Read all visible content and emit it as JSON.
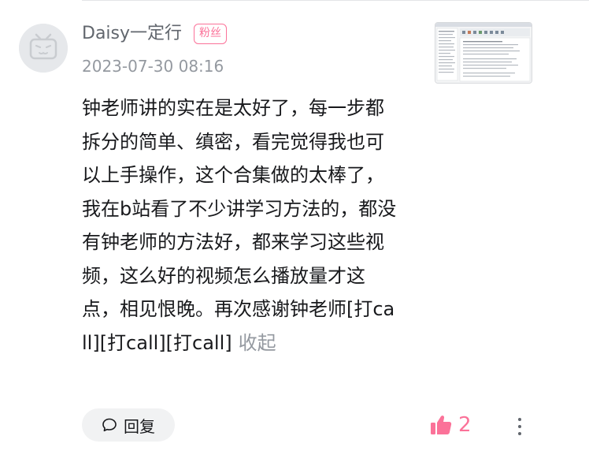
{
  "comment": {
    "username": "Daisy一定行",
    "badge": "粉丝",
    "timestamp": "2023-07-30 08:16",
    "text": "钟老师讲的实在是太好了，每一步都拆分的简单、缜密，看完觉得我也可以上手操作，这个合集做的太棒了，我在b站看了不少讲学习方法的，都没有钟老师的方法好，都来学习这些视频，这么好的视频怎么播放量才这点，相见恨晚。再次感谢钟老师[打call][打call][打call]",
    "collapse_label": "收起"
  },
  "actions": {
    "reply_label": "回复",
    "like_count": "2"
  },
  "icons": {
    "avatar": "bilibili-tv-avatar-icon",
    "reply": "chat-bubble-icon",
    "like": "thumbs-up-icon",
    "more": "vertical-dots-icon"
  },
  "colors": {
    "accent": "#fb7299",
    "secondary_text": "#9499a0",
    "username": "#61666d",
    "body_text": "#18191c",
    "button_bg": "#f1f2f3"
  }
}
